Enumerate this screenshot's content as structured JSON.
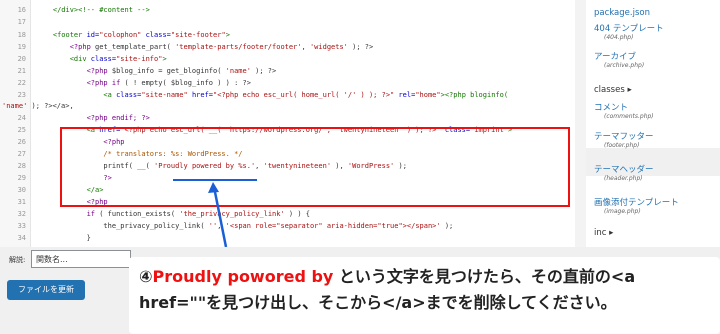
{
  "code_lines": [
    {
      "n": "16",
      "parts": [
        {
          "c": "t-tag",
          "t": "    </div><!-- #content -->"
        }
      ]
    },
    {
      "n": "17",
      "parts": [
        {
          "c": "t-plain",
          "t": ""
        }
      ]
    },
    {
      "n": "18",
      "parts": [
        {
          "c": "t-tag",
          "t": "    <footer "
        },
        {
          "c": "t-attr",
          "t": "id="
        },
        {
          "c": "t-str",
          "t": "\"colophon\" "
        },
        {
          "c": "t-attr",
          "t": "class="
        },
        {
          "c": "t-str",
          "t": "\"site-footer\""
        },
        {
          "c": "t-tag",
          "t": ">"
        }
      ]
    },
    {
      "n": "19",
      "parts": [
        {
          "c": "t-kw",
          "t": "        <?php "
        },
        {
          "c": "t-plain",
          "t": "get_template_part( "
        },
        {
          "c": "t-str",
          "t": "'template-parts/footer/footer'"
        },
        {
          "c": "t-plain",
          "t": ", "
        },
        {
          "c": "t-str",
          "t": "'widgets'"
        },
        {
          "c": "t-plain",
          "t": " ); ?>"
        }
      ]
    },
    {
      "n": "20",
      "parts": [
        {
          "c": "t-tag",
          "t": "        <div "
        },
        {
          "c": "t-attr",
          "t": "class="
        },
        {
          "c": "t-str",
          "t": "\"site-info\""
        },
        {
          "c": "t-tag",
          "t": ">"
        }
      ]
    },
    {
      "n": "21",
      "parts": [
        {
          "c": "t-kw",
          "t": "            <?php "
        },
        {
          "c": "t-plain",
          "t": "$blog_info = get_bloginfo( "
        },
        {
          "c": "t-str",
          "t": "'name'"
        },
        {
          "c": "t-plain",
          "t": " ); ?>"
        }
      ]
    },
    {
      "n": "22",
      "parts": [
        {
          "c": "t-kw",
          "t": "            <?php "
        },
        {
          "c": "t-kw",
          "t": "if"
        },
        {
          "c": "t-plain",
          "t": " ( ! empty( $blog_info ) ) : ?>"
        }
      ]
    },
    {
      "n": "23",
      "parts": [
        {
          "c": "t-tag",
          "t": "                <a "
        },
        {
          "c": "t-attr",
          "t": "class="
        },
        {
          "c": "t-str",
          "t": "\"site-name\" "
        },
        {
          "c": "t-attr",
          "t": "href="
        },
        {
          "c": "t-str",
          "t": "\"<?php echo esc_url( home_url( '/' ) ); ?>\" "
        },
        {
          "c": "t-attr",
          "t": "rel="
        },
        {
          "c": "t-str",
          "t": "\"home\""
        },
        {
          "c": "t-tag",
          "t": "><?php bloginfo("
        }
      ]
    },
    {
      "n": "",
      "parts": [
        {
          "c": "t-str",
          "t": "'name'"
        },
        {
          "c": "t-plain",
          "t": " ); ?></a>,"
        }
      ]
    },
    {
      "n": "24",
      "parts": [
        {
          "c": "t-kw",
          "t": "            <?php endif; ?>"
        }
      ]
    },
    {
      "n": "25",
      "parts": [
        {
          "c": "t-tag",
          "t": "            <a "
        },
        {
          "c": "t-attr",
          "t": "href="
        },
        {
          "c": "t-str",
          "t": "\"<?php echo esc_url( __( 'https://wordpress.org/', 'twentynineteen' ) ); ?>\" "
        },
        {
          "c": "t-attr",
          "t": "class="
        },
        {
          "c": "t-str",
          "t": "\"imprint\""
        },
        {
          "c": "t-tag",
          "t": ">"
        }
      ]
    },
    {
      "n": "26",
      "parts": [
        {
          "c": "t-kw",
          "t": "                <?php"
        }
      ]
    },
    {
      "n": "27",
      "parts": [
        {
          "c": "t-cm",
          "t": "                /* translators: %s: WordPress. */"
        }
      ]
    },
    {
      "n": "28",
      "parts": [
        {
          "c": "t-plain",
          "t": "                printf( __( "
        },
        {
          "c": "t-str",
          "t": "'Proudly powered by %s.'"
        },
        {
          "c": "t-plain",
          "t": ", "
        },
        {
          "c": "t-str",
          "t": "'twentynineteen'"
        },
        {
          "c": "t-plain",
          "t": " ), "
        },
        {
          "c": "t-str",
          "t": "'WordPress'"
        },
        {
          "c": "t-plain",
          "t": " );"
        }
      ]
    },
    {
      "n": "29",
      "parts": [
        {
          "c": "t-kw",
          "t": "                ?>"
        }
      ]
    },
    {
      "n": "30",
      "parts": [
        {
          "c": "t-tag",
          "t": "            </a>"
        }
      ]
    },
    {
      "n": "31",
      "parts": [
        {
          "c": "t-kw",
          "t": "            <?php"
        }
      ]
    },
    {
      "n": "32",
      "parts": [
        {
          "c": "t-kw",
          "t": "            if"
        },
        {
          "c": "t-plain",
          "t": " ( function_exists( "
        },
        {
          "c": "t-str",
          "t": "'the_privacy_policy_link'"
        },
        {
          "c": "t-plain",
          "t": " ) ) {"
        }
      ]
    },
    {
      "n": "33",
      "parts": [
        {
          "c": "t-plain",
          "t": "                the_privacy_policy_link( "
        },
        {
          "c": "t-str",
          "t": "''"
        },
        {
          "c": "t-plain",
          "t": ", "
        },
        {
          "c": "t-str",
          "t": "'<span role=\"separator\" aria-hidden=\"true\"></span>'"
        },
        {
          "c": "t-plain",
          "t": " );"
        }
      ]
    },
    {
      "n": "34",
      "parts": [
        {
          "c": "t-plain",
          "t": "            }"
        }
      ]
    }
  ],
  "sidebar": {
    "items": [
      {
        "label": "package.json",
        "sub": ""
      },
      {
        "label": "404 テンプレート",
        "sub": "(404.php)"
      },
      {
        "label": "アーカイブ",
        "sub": "(archive.php)"
      },
      {
        "label": "classes ▸",
        "sub": "",
        "folder": true
      },
      {
        "label": "コメント",
        "sub": "(comments.php)"
      },
      {
        "label": "テーマフッター",
        "sub": "(footer.php)"
      },
      {
        "label": "テーマヘッダー",
        "sub": "(header.php)"
      },
      {
        "label": "画像添付テンプレート",
        "sub": "(image.php)"
      },
      {
        "label": "inc ▸",
        "sub": "",
        "folder": true
      }
    ]
  },
  "bottom": {
    "doc_label": "解説:",
    "doc_input_placeholder": "関数名...",
    "update_button": "ファイルを更新"
  },
  "instruction": {
    "line1_prefix": "④",
    "line1_highlight": "Proudly powored by",
    "line1_rest": " という文字を見つけたら、その直前の<a",
    "line2": "href=\"\"を見つけ出し、そこから</a>までを削除してください。"
  },
  "colors": {
    "highlight_box": "#e11111",
    "arrow": "#1b5fd6",
    "primary_button": "#2271b1"
  }
}
